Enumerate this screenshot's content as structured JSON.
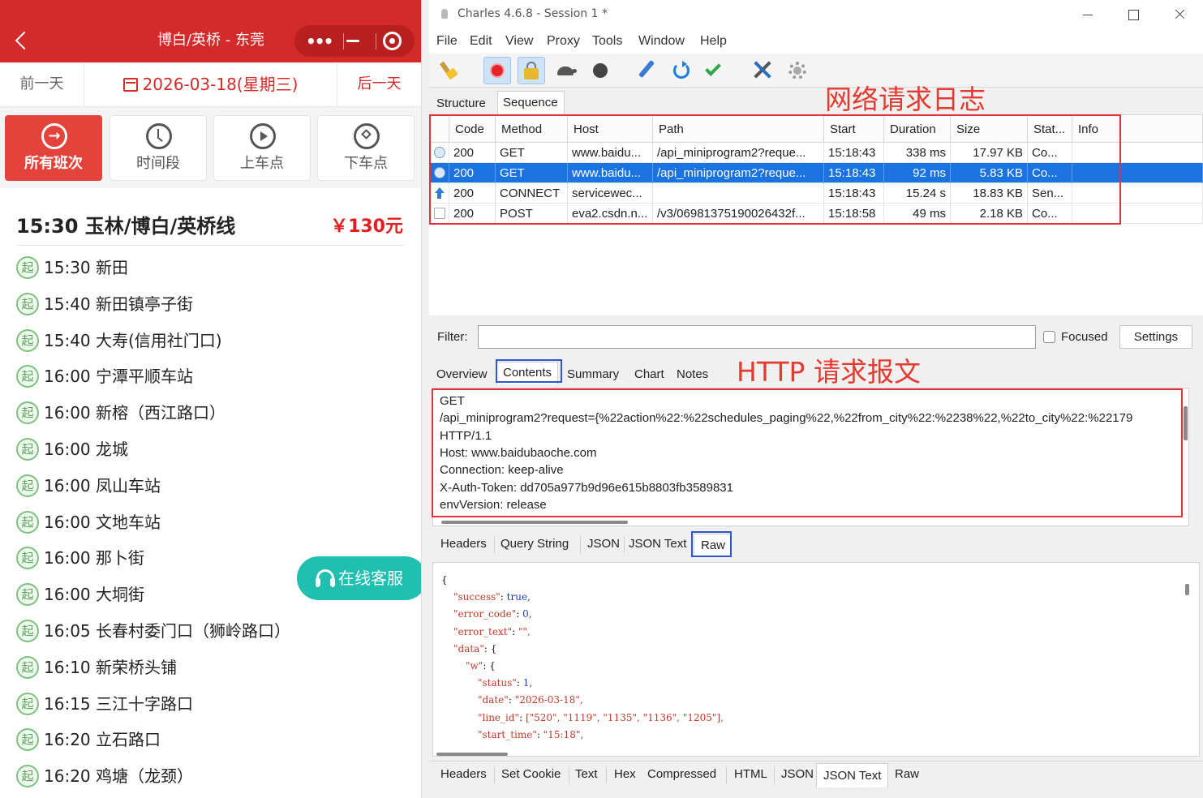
{
  "miniapp": {
    "title": "博白/英桥 - 东莞",
    "prev_day": "前一天",
    "date": "2026-03-18(星期三)",
    "next_day": "后一天",
    "filters": [
      {
        "label": "所有班次",
        "icon": "arrow-circle-icon",
        "active": true
      },
      {
        "label": "时间段",
        "icon": "clock-icon",
        "active": false
      },
      {
        "label": "上车点",
        "icon": "play-circle-icon",
        "active": false
      },
      {
        "label": "下车点",
        "icon": "compass-icon",
        "active": false
      }
    ],
    "route": {
      "name": "15:30 玉林/博白/英桥线",
      "price": "￥130元"
    },
    "stop_badge": "起",
    "stops": [
      "15:30 新田",
      "15:40 新田镇亭子街",
      "15:40 大寿(信用社门口)",
      "16:00 宁潭平顺车站",
      "16:00 新榕（西江路口）",
      "16:00 龙城",
      "16:00 凤山车站",
      "16:00 文地车站",
      "16:00 那卜街",
      "16:00 大垌街",
      "16:05 长春村委门口（狮岭路口）",
      "16:10 新荣桥头铺",
      "16:15 三江十字路口",
      "16:20 立石路口",
      "16:20 鸡塘（龙颈）"
    ],
    "service": "在线客服"
  },
  "charles": {
    "window_title": "Charles 4.6.8 - Session 1 *",
    "menu": [
      "File",
      "Edit",
      "View",
      "Proxy",
      "Tools",
      "Window",
      "Help"
    ],
    "toolbar": [
      "broom-icon",
      "record-icon",
      "lock-icon",
      "turtle-icon",
      "stop-icon",
      "pen-icon",
      "refresh-icon",
      "check-icon",
      "tools-icon",
      "gear-icon"
    ],
    "view_tabs": [
      "Structure",
      "Sequence"
    ],
    "annotation_top": "网络请求日志",
    "columns": [
      "Code",
      "Method",
      "Host",
      "Path",
      "Start",
      "Duration",
      "Size",
      "Stat...",
      "Info"
    ],
    "rows": [
      {
        "code": "200",
        "method": "GET",
        "host": "www.baidu...",
        "path": "/api_miniprogram2?reque...",
        "start": "15:18:43",
        "duration": "338 ms",
        "size": "17.97 KB",
        "status": "Co...",
        "info": ""
      },
      {
        "code": "200",
        "method": "GET",
        "host": "www.baidu...",
        "path": "/api_miniprogram2?reque...",
        "start": "15:18:43",
        "duration": "92 ms",
        "size": "5.83 KB",
        "status": "Co...",
        "info": ""
      },
      {
        "code": "200",
        "method": "CONNECT",
        "host": "servicewec...",
        "path": "",
        "start": "15:18:43",
        "duration": "15.24 s",
        "size": "18.83 KB",
        "status": "Sen...",
        "info": ""
      },
      {
        "code": "200",
        "method": "POST",
        "host": "eva2.csdn.n...",
        "path": "/v3/06981375190026432f...",
        "start": "15:18:58",
        "duration": "49 ms",
        "size": "2.18 KB",
        "status": "Co...",
        "info": ""
      }
    ],
    "filter": {
      "label": "Filter:",
      "value": "",
      "focused_label": "Focused",
      "settings_label": "Settings"
    },
    "detail_tabs": [
      "Overview",
      "Contents",
      "Summary",
      "Chart",
      "Notes"
    ],
    "annotation_mid": "HTTP 请求报文",
    "request_lines": [
      "GET",
      "/api_miniprogram2?request={%22action%22:%22schedules_paging%22,%22from_city%22:%2238%22,%22to_city%22:%22179",
      " HTTP/1.1",
      "Host: www.baidubaoche.com",
      "Connection: keep-alive",
      "X-Auth-Token: dd705a977b9d96e615b8803fb3589831",
      "envVersion: release"
    ],
    "request_tabs": [
      "Headers",
      "Query String",
      "JSON",
      "JSON Text",
      "Raw"
    ],
    "json_lines": [
      {
        "indent": 0,
        "key": "",
        "value": "{"
      },
      {
        "indent": 1,
        "key": "\"success\"",
        "value": "true,"
      },
      {
        "indent": 1,
        "key": "\"error_code\"",
        "value": "0,"
      },
      {
        "indent": 1,
        "key": "\"error_text\"",
        "value": "\"\","
      },
      {
        "indent": 1,
        "key": "\"data\"",
        "value": "{"
      },
      {
        "indent": 2,
        "key": "\"w\"",
        "value": "{"
      },
      {
        "indent": 3,
        "key": "\"status\"",
        "value": "1,"
      },
      {
        "indent": 3,
        "key": "\"date\"",
        "value": "\"2026-03-18\","
      },
      {
        "indent": 3,
        "key": "\"line_id\"",
        "value": "[\"520\", \"1119\", \"1135\", \"1136\", \"1205\"],"
      },
      {
        "indent": 3,
        "key": "\"start_time\"",
        "value": "\"15:18\","
      }
    ],
    "response_tabs": [
      "Headers",
      "Set Cookie",
      "Text",
      "Hex",
      "Compressed",
      "HTML",
      "JSON",
      "JSON Text",
      "Raw"
    ]
  }
}
